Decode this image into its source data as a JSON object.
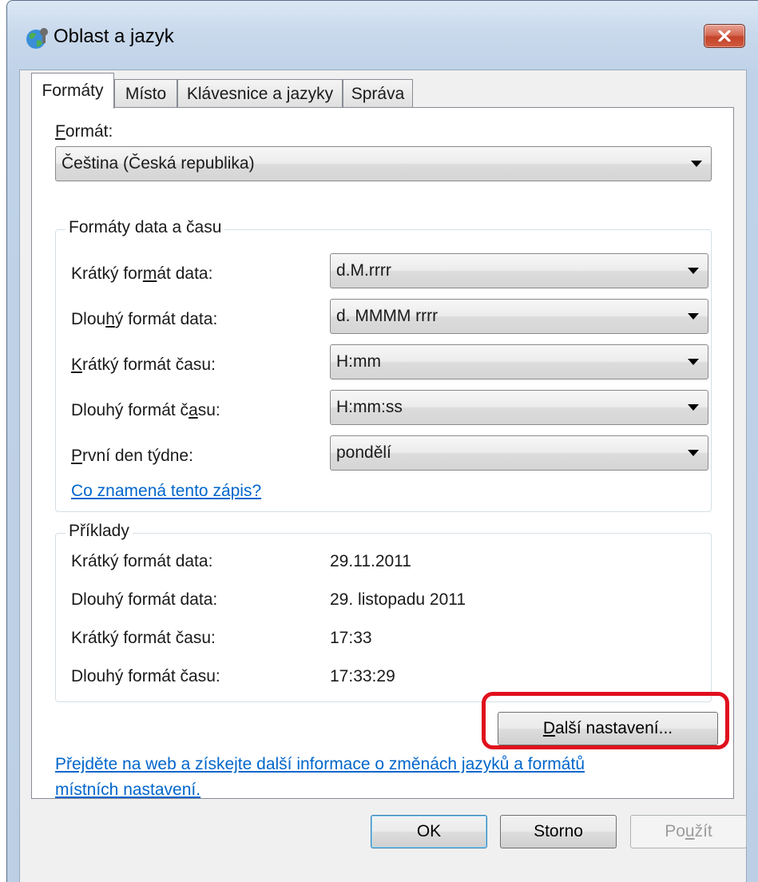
{
  "window": {
    "title": "Oblast a jazyk",
    "icon": "globe-icon",
    "close_icon": "close-icon"
  },
  "tabs": [
    {
      "label": "Formáty",
      "active": true
    },
    {
      "label": "Místo",
      "active": false
    },
    {
      "label": "Klávesnice a jazyky",
      "active": false
    },
    {
      "label": "Správa",
      "active": false
    }
  ],
  "format": {
    "label": "Formát:",
    "value": "Čeština (Česká republika)"
  },
  "date_time_formats": {
    "title": "Formáty data a času",
    "rows": [
      {
        "label": "Krátký formát data:",
        "value": "d.M.rrrr"
      },
      {
        "label": "Dlouhý formát data:",
        "value": "d. MMMM rrrr"
      },
      {
        "label": "Krátký formát času:",
        "value": "H:mm"
      },
      {
        "label": "Dlouhý formát času:",
        "value": "H:mm:ss"
      },
      {
        "label": "První den týdne:",
        "value": "pondělí"
      }
    ],
    "help_link": "Co znamená tento zápis?"
  },
  "examples": {
    "title": "Příklady",
    "rows": [
      {
        "label": "Krátký formát data:",
        "value": "29.11.2011"
      },
      {
        "label": "Dlouhý formát data:",
        "value": "29. listopadu 2011"
      },
      {
        "label": "Krátký formát času:",
        "value": "17:33"
      },
      {
        "label": "Dlouhý formát času:",
        "value": "17:33:29"
      }
    ]
  },
  "more_settings_button": "Další nastavení...",
  "web_link": {
    "line1": "Přejděte na web a získejte další informace o změnách jazyků a formátů",
    "line2": "místních nastavení."
  },
  "buttons": {
    "ok": "OK",
    "cancel": "Storno",
    "apply": "Použít"
  },
  "colors": {
    "link": "#0066cc",
    "highlight": "#e0101e",
    "close_button": "#c4432a"
  }
}
